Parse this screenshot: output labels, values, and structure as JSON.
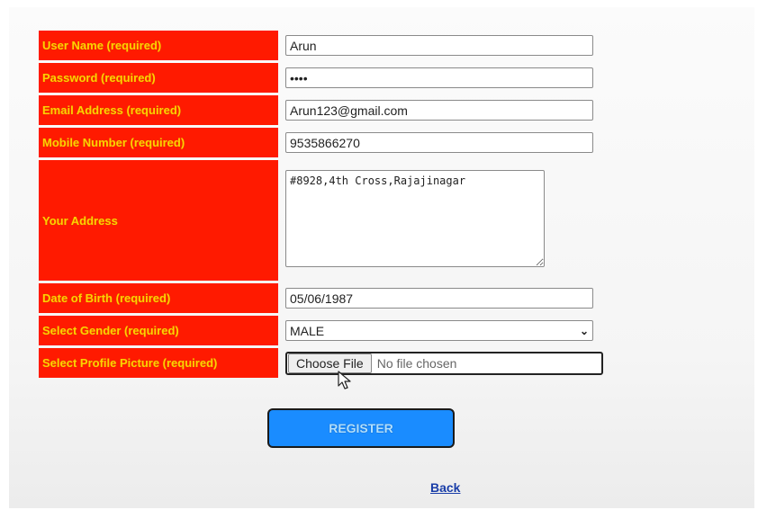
{
  "form": {
    "username": {
      "label": "User Name (required)",
      "value": "Arun"
    },
    "password": {
      "label": "Password (required)",
      "value": "••••"
    },
    "email": {
      "label": "Email Address (required)",
      "value": "Arun123@gmail.com"
    },
    "mobile": {
      "label": "Mobile Number (required)",
      "value": "9535866270"
    },
    "address": {
      "label": "Your Address",
      "value": "#8928,4th Cross,Rajajinagar"
    },
    "dob": {
      "label": "Date of Birth (required)",
      "value": "05/06/1987"
    },
    "gender": {
      "label": "Select Gender (required)",
      "value": "MALE"
    },
    "picture": {
      "label": "Select Profile Picture (required)",
      "button_label": "Choose File",
      "status": "No file chosen"
    }
  },
  "actions": {
    "register_label": "REGISTER",
    "back_label": "Back"
  },
  "icons": {
    "select_arrow": "chevron-down-icon",
    "cursor": "mouse-pointer-icon"
  },
  "colors": {
    "label_bg": "#ff1a00",
    "label_text": "#ffd000",
    "register_bg": "#1a8cff",
    "link": "#1a3ea8"
  }
}
